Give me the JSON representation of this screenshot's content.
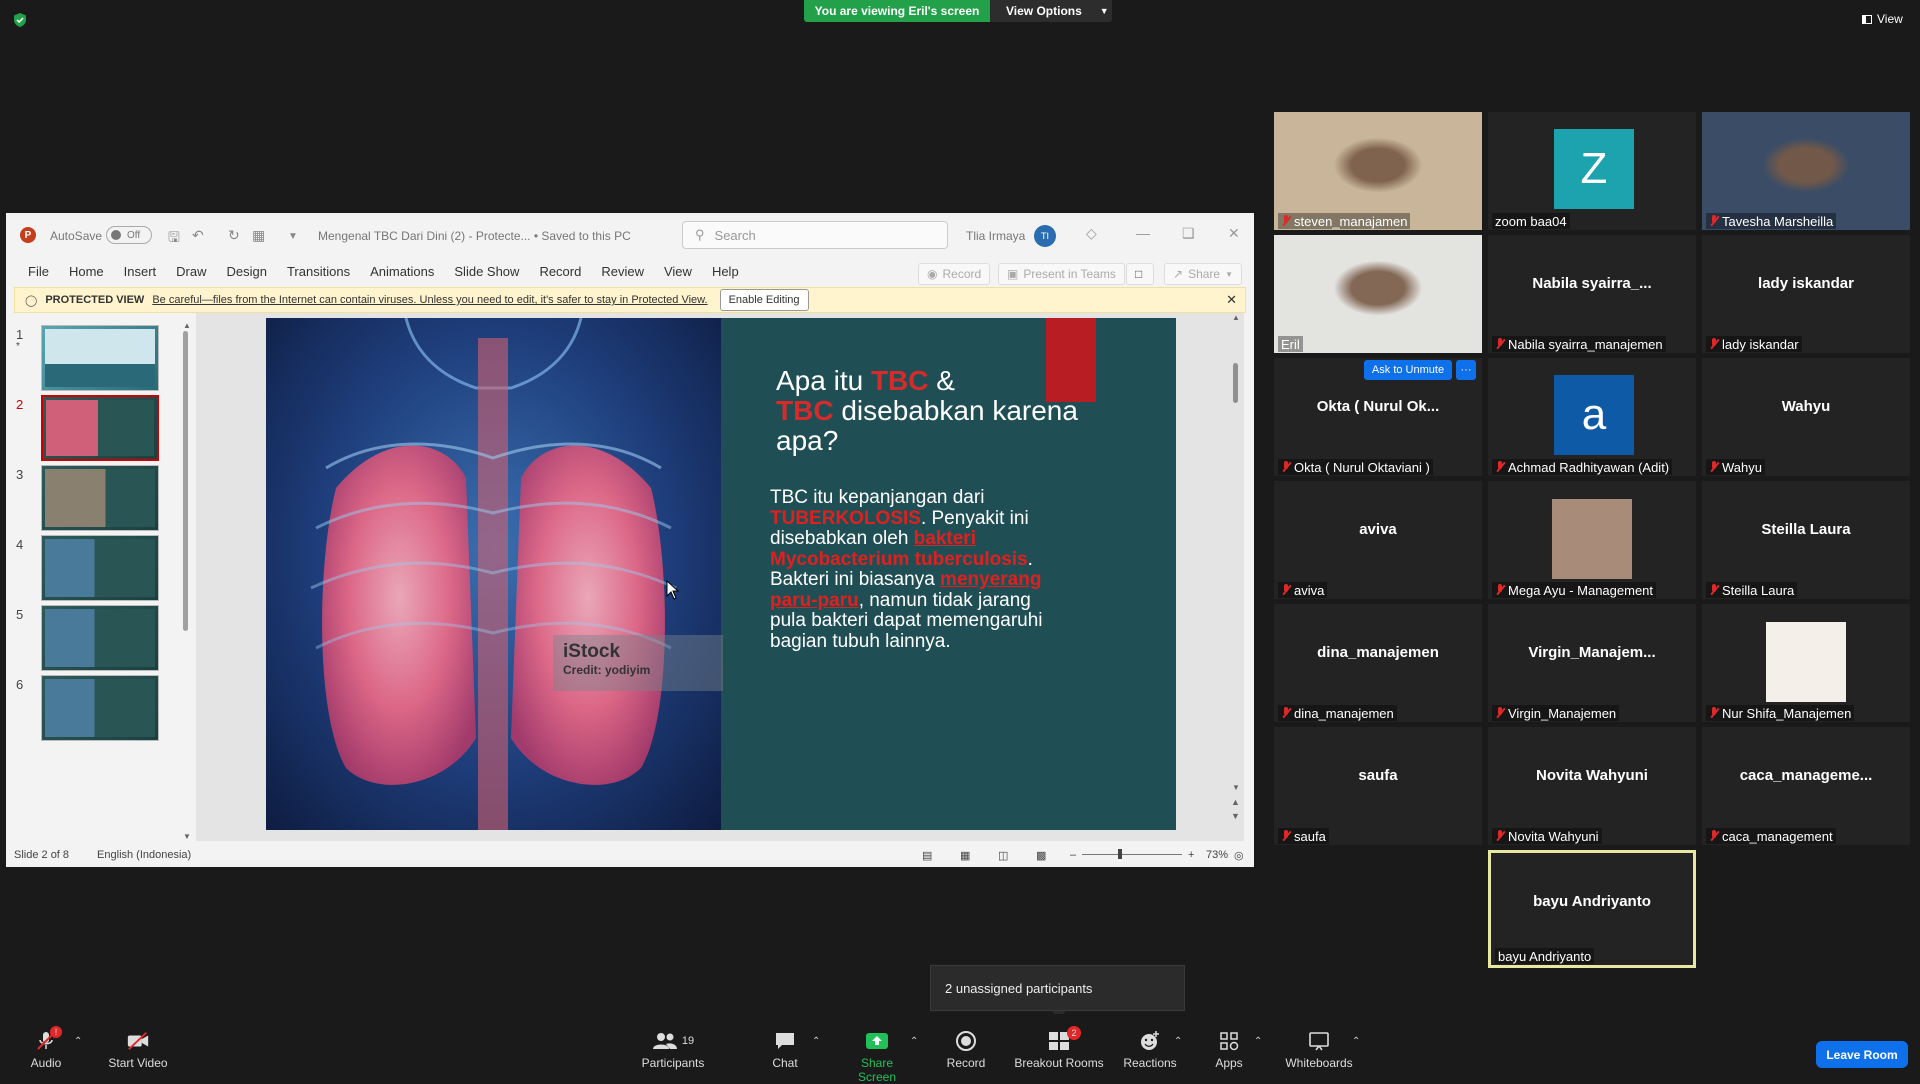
{
  "zoom": {
    "banner": "You are viewing Eril's screen",
    "view_options": "View Options",
    "view_label": "View",
    "unassigned": "2 unassigned participants",
    "leave": "Leave Room",
    "toolbar": {
      "audio": "Audio",
      "audio_badge": "!",
      "video": "Start Video",
      "participants": "Participants",
      "participants_count": "19",
      "chat": "Chat",
      "share": "Share Screen",
      "record": "Record",
      "breakout": "Breakout Rooms",
      "breakout_badge": "2",
      "reactions": "Reactions",
      "apps": "Apps",
      "whiteboards": "Whiteboards"
    },
    "ask_unmute": "Ask to Unmute",
    "more": "···"
  },
  "gallery": [
    {
      "label": "steven_manajamen",
      "muted": true,
      "type": "video",
      "bg": "#c8b59a"
    },
    {
      "label": "zoom baa04",
      "muted": false,
      "type": "avatar",
      "letter": "Z",
      "avatar_color": "#1ca3ad"
    },
    {
      "label": "Tavesha Marsheilla",
      "muted": true,
      "type": "video",
      "bg": "#3a4c66"
    },
    {
      "label": "Eril",
      "muted": false,
      "type": "video",
      "bg": "#e3e3e0"
    },
    {
      "label": "Nabila syairra_manajemen",
      "name": "Nabila  syairra_...",
      "muted": true,
      "type": "name"
    },
    {
      "label": "lady iskandar",
      "name": "lady iskandar",
      "muted": true,
      "type": "name"
    },
    {
      "label": "Okta ( Nurul Oktaviani )",
      "name": "Okta ( Nurul Ok...",
      "muted": true,
      "type": "name"
    },
    {
      "label": "Achmad Radhityawan (Adit)",
      "muted": true,
      "type": "avatar",
      "letter": "a",
      "avatar_color": "#0e5aa7"
    },
    {
      "label": "Wahyu",
      "name": "Wahyu",
      "muted": true,
      "type": "name"
    },
    {
      "label": "aviva",
      "name": "aviva",
      "muted": true,
      "type": "name"
    },
    {
      "label": "Mega Ayu - Management",
      "muted": true,
      "type": "photo",
      "bg": "#a88b78"
    },
    {
      "label": "Steilla Laura",
      "name": "Steilla Laura",
      "muted": true,
      "type": "name"
    },
    {
      "label": "dina_manajemen",
      "name": "dina_manajemen",
      "muted": true,
      "type": "name"
    },
    {
      "label": "Virgin_Manajemen",
      "name": "Virgin_Manajem...",
      "muted": true,
      "type": "name"
    },
    {
      "label": "Nur Shifa_Manajemen",
      "muted": true,
      "type": "photo",
      "bg": "#f4efe9"
    },
    {
      "label": "saufa",
      "name": "saufa",
      "muted": true,
      "type": "name"
    },
    {
      "label": "Novita Wahyuni",
      "name": "Novita Wahyuni",
      "muted": true,
      "type": "name"
    },
    {
      "label": "caca_management",
      "name": "caca_manageme...",
      "muted": true,
      "type": "name"
    },
    {
      "label": "bayu Andriyanto",
      "name": "bayu Andriyanto",
      "muted": false,
      "type": "name",
      "active": true
    }
  ],
  "ppt": {
    "autosave": "AutoSave",
    "toggle": "Off",
    "doc_title": "Mengenal TBC Dari Dini (2)  -  Protecte...   •  Saved to this PC",
    "search": "Search",
    "user": "Tlia Irmaya",
    "user_initials": "TI",
    "menu": [
      "File",
      "Home",
      "Insert",
      "Draw",
      "Design",
      "Transitions",
      "Animations",
      "Slide Show",
      "Record",
      "Review",
      "View",
      "Help"
    ],
    "record_btn": "Record",
    "present_btn": "Present in Teams",
    "share_btn": "Share",
    "protected_label": "PROTECTED VIEW",
    "protected_msg": "Be careful—files from the Internet can contain viruses. Unless you need to edit, it's safer to stay in Protected View.",
    "enable_editing": "Enable Editing",
    "thumbs": [
      "1",
      "2",
      "3",
      "4",
      "5",
      "6"
    ],
    "status_slide": "Slide 2 of 8",
    "status_lang": "English (Indonesia)",
    "zoom_pct": "73%",
    "slide": {
      "title_1": "Apa itu ",
      "title_tbc1": "TBC",
      "title_2": "  &",
      "title_tbc2": "TBC",
      "title_3": " disebabkan karena apa?",
      "body_1": "TBC itu kepanjangan dari ",
      "body_red1": "TUBERKOLOSIS",
      "body_2": ". Penyakit ini disebabkan oleh ",
      "body_red2": "bakteri",
      "body_red3": " Mycobacterium tuberculosis",
      "body_3": ". Bakteri ini biasanya ",
      "body_red4": "menyerang paru-paru",
      "body_4": ", namun tidak jarang pula bakteri dapat memengaruhi bagian tubuh lainnya.",
      "istock": "iStock",
      "credit": "Credit: yodiyim"
    }
  }
}
